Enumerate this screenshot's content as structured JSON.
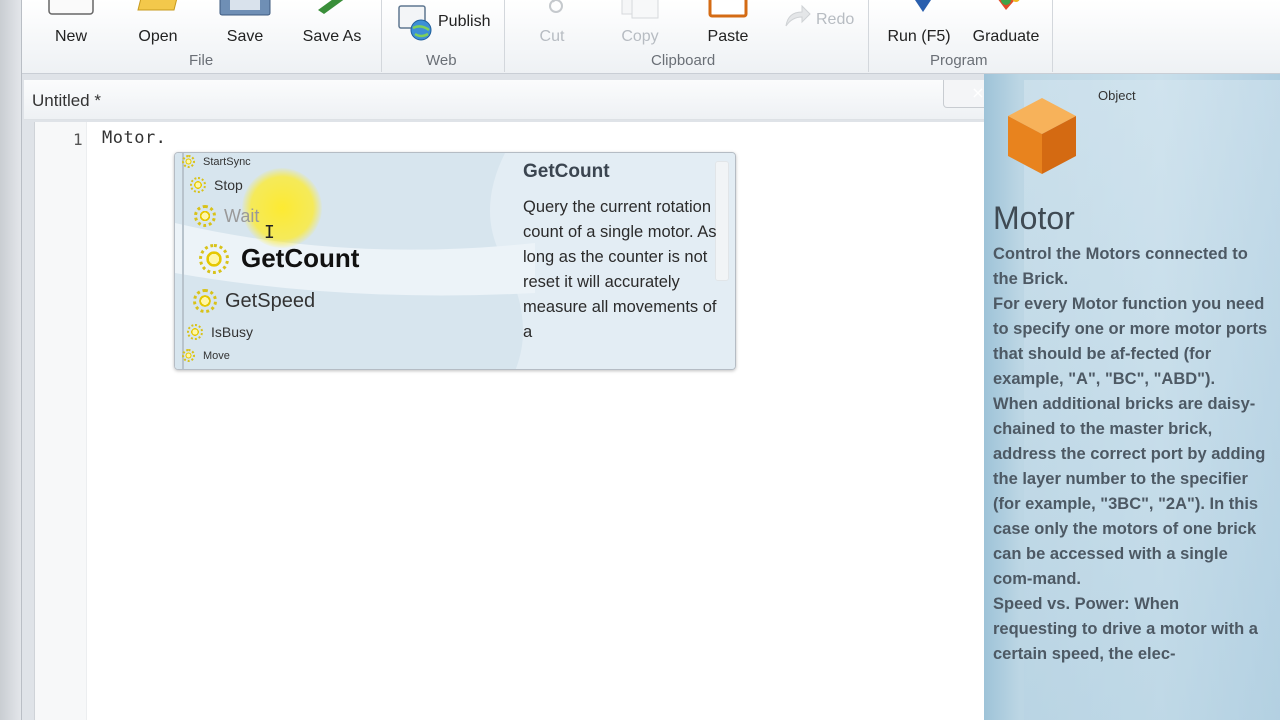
{
  "ribbon": {
    "file": {
      "group_label": "File",
      "new": "New",
      "open": "Open",
      "save": "Save",
      "save_as": "Save As"
    },
    "web": {
      "group_label": "Web",
      "publish": "Publish"
    },
    "clipboard": {
      "group_label": "Clipboard",
      "cut": "Cut",
      "copy": "Copy",
      "paste": "Paste",
      "redo": "Redo"
    },
    "program": {
      "group_label": "Program",
      "run": "Run (F5)",
      "graduate": "Graduate"
    }
  },
  "editor": {
    "title": "Untitled *",
    "close_glyph": "×",
    "line_number": "1",
    "code": "Motor."
  },
  "intellisense": {
    "items": [
      "StartSync",
      "Stop",
      "Wait",
      "GetCount",
      "GetSpeed",
      "IsBusy",
      "Move"
    ],
    "selected": "GetCount",
    "detail_title": "GetCount",
    "detail_text": "Query the current rotation count of a single motor. As long as the counter is not reset it will accurately measure all movements of a"
  },
  "help_panel": {
    "object_label": "Object",
    "title": "Motor",
    "paragraphs": [
      "Control the Motors connected to the Brick.",
      "For every Motor function you need to specify one or more motor ports that should be af-fected (for example, \"A\", \"BC\", \"ABD\").",
      "When additional bricks are daisy-chained to the master brick, address the correct port by adding the layer number to the specifier (for example, \"3BC\", \"2A\"). In this case only the motors of one brick can be accessed with a single com-mand.",
      "Speed vs. Power: When requesting to drive a motor with a certain speed, the elec-"
    ]
  },
  "colors": {
    "accent": "#d8c21a",
    "help_bg": "#c9dfeb",
    "title_text": "#3f4a53"
  }
}
